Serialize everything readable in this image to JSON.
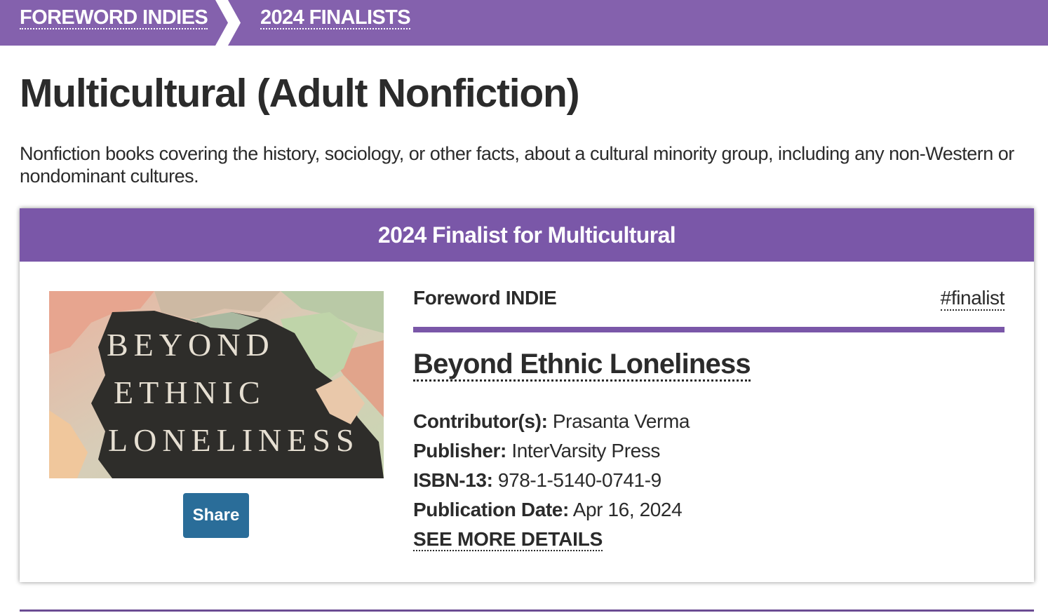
{
  "breadcrumb": {
    "items": [
      "FOREWORD INDIES",
      "2024 FINALISTS"
    ],
    "bg_color": "#8461ad"
  },
  "page": {
    "title": "Multicultural (Adult Nonfiction)",
    "description": "Nonfiction books covering the history, sociology, or other facts, about a cultural minority group, including any non-Western or nondominant cultures."
  },
  "card": {
    "header": "2024 Finalist for Multicultural",
    "header_color": "#7a57a8",
    "award_label": "Foreword INDIE",
    "tag": "#finalist",
    "cover": {
      "lines": [
        "BEYOND",
        "ETHNIC",
        "LONELINESS"
      ]
    },
    "share_label": "Share",
    "share_color": "#2a6d99",
    "book_title": "Beyond Ethnic Loneliness",
    "meta": [
      {
        "key": "Contributor(s):",
        "value": "Prasanta Verma"
      },
      {
        "key": "Publisher:",
        "value": "InterVarsity Press"
      },
      {
        "key": "ISBN-13:",
        "value": "978-1-5140-0741-9"
      },
      {
        "key": "Publication Date:",
        "value": "Apr 16, 2024"
      }
    ],
    "see_more": "SEE MORE DETAILS"
  }
}
